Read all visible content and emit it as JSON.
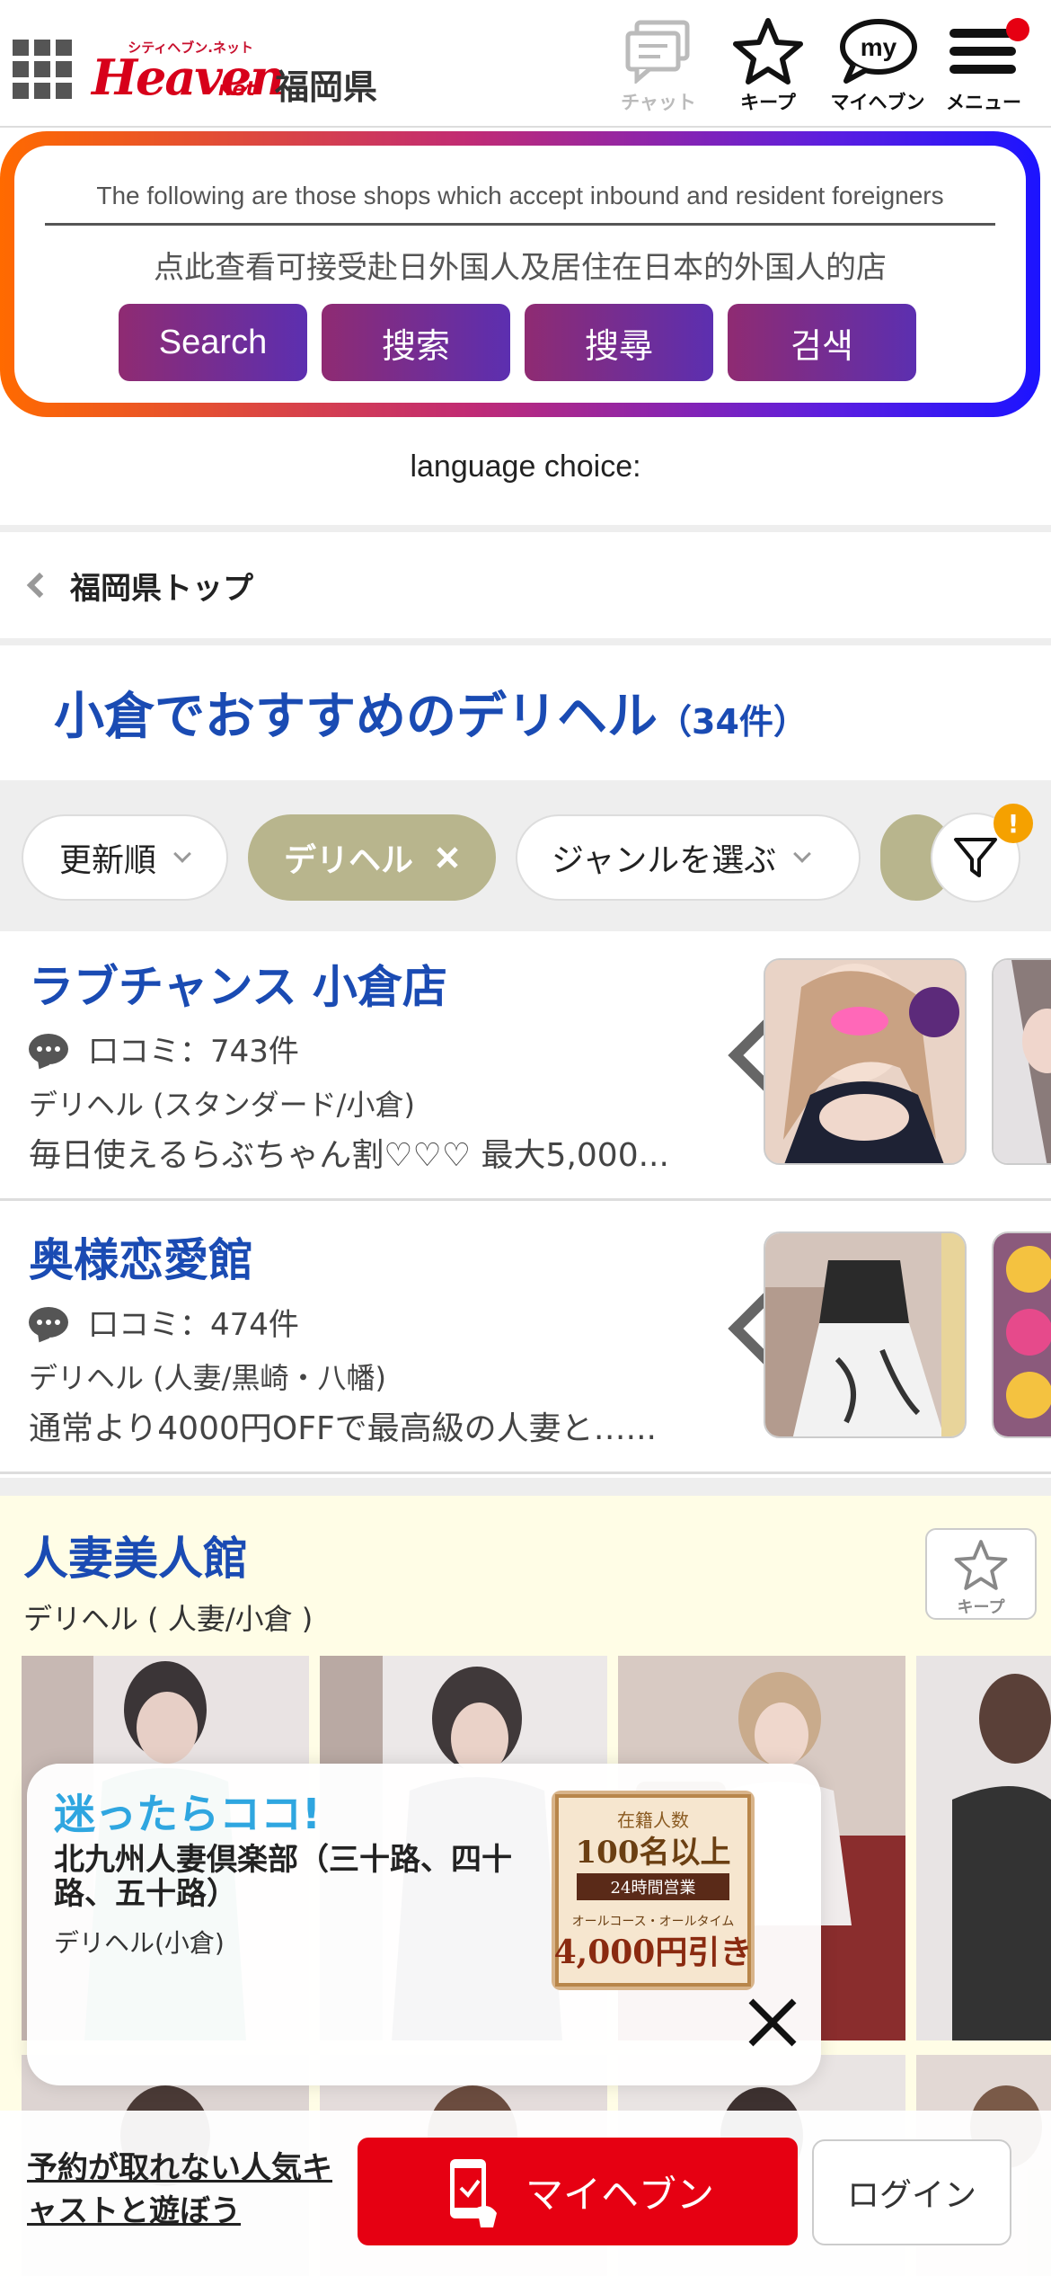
{
  "header": {
    "pref": "福岡県",
    "logo": {
      "small": "シティヘブン.ネット",
      "main": "Heaven",
      "net": "net"
    },
    "buttons": {
      "chat": "チャット",
      "keep": "キープ",
      "myheaven": "マイヘブン",
      "menu": "メニュー"
    },
    "colors": {
      "brand": "#d7001a",
      "notification": "#e60012"
    }
  },
  "foreign": {
    "english": "The following are those shops which accept inbound and resident foreigners",
    "chinese": "点此查看可接受赴日外国人及居住在日本的外国人的店",
    "languages": [
      "Search",
      "搜索",
      "搜尋",
      "검색"
    ],
    "choice_label": "language choice:"
  },
  "breadcrumb": {
    "label": "福岡県トップ"
  },
  "page": {
    "title": "小倉でおすすめのデリヘル",
    "count": "（34件）",
    "title_color": "#1a4bb3"
  },
  "filters": {
    "sort": "更新順",
    "active": "デリヘル",
    "genre": "ジャンルを選ぶ",
    "badge": "!"
  },
  "shops": [
    {
      "name": "ラブチャンス 小倉店",
      "reviews": "口コミ：743件",
      "genre": "デリヘル (スタンダード/小倉)",
      "desc": "毎日使えるらぶちゃん割♡♡♡ 最大5,000..."
    },
    {
      "name": "奥様恋愛館",
      "reviews": "口コミ：474件",
      "genre": "デリヘル (人妻/黒崎・八幡)",
      "desc": "通常より4000円OFFで最高級の人妻と…..."
    }
  ],
  "featured": {
    "name": "人妻美人館",
    "genre": "デリヘル ( 人妻/小倉 )",
    "keep_label": "キープ"
  },
  "popup": {
    "headline": "迷ったらココ!",
    "name": "北九州人妻倶楽部（三十路、四十路、五十路）",
    "genre": "デリヘル(小倉)",
    "ad": {
      "line1": "在籍人数",
      "line2": "100名以上",
      "line3": "24時間営業",
      "line4": "オールコース・オールタイム",
      "line5": "4,000円引き"
    }
  },
  "bottom": {
    "promo": "予約が取れない人気キャストと遊ぼう",
    "myheaven": "マイヘブン",
    "login": "ログイン"
  }
}
